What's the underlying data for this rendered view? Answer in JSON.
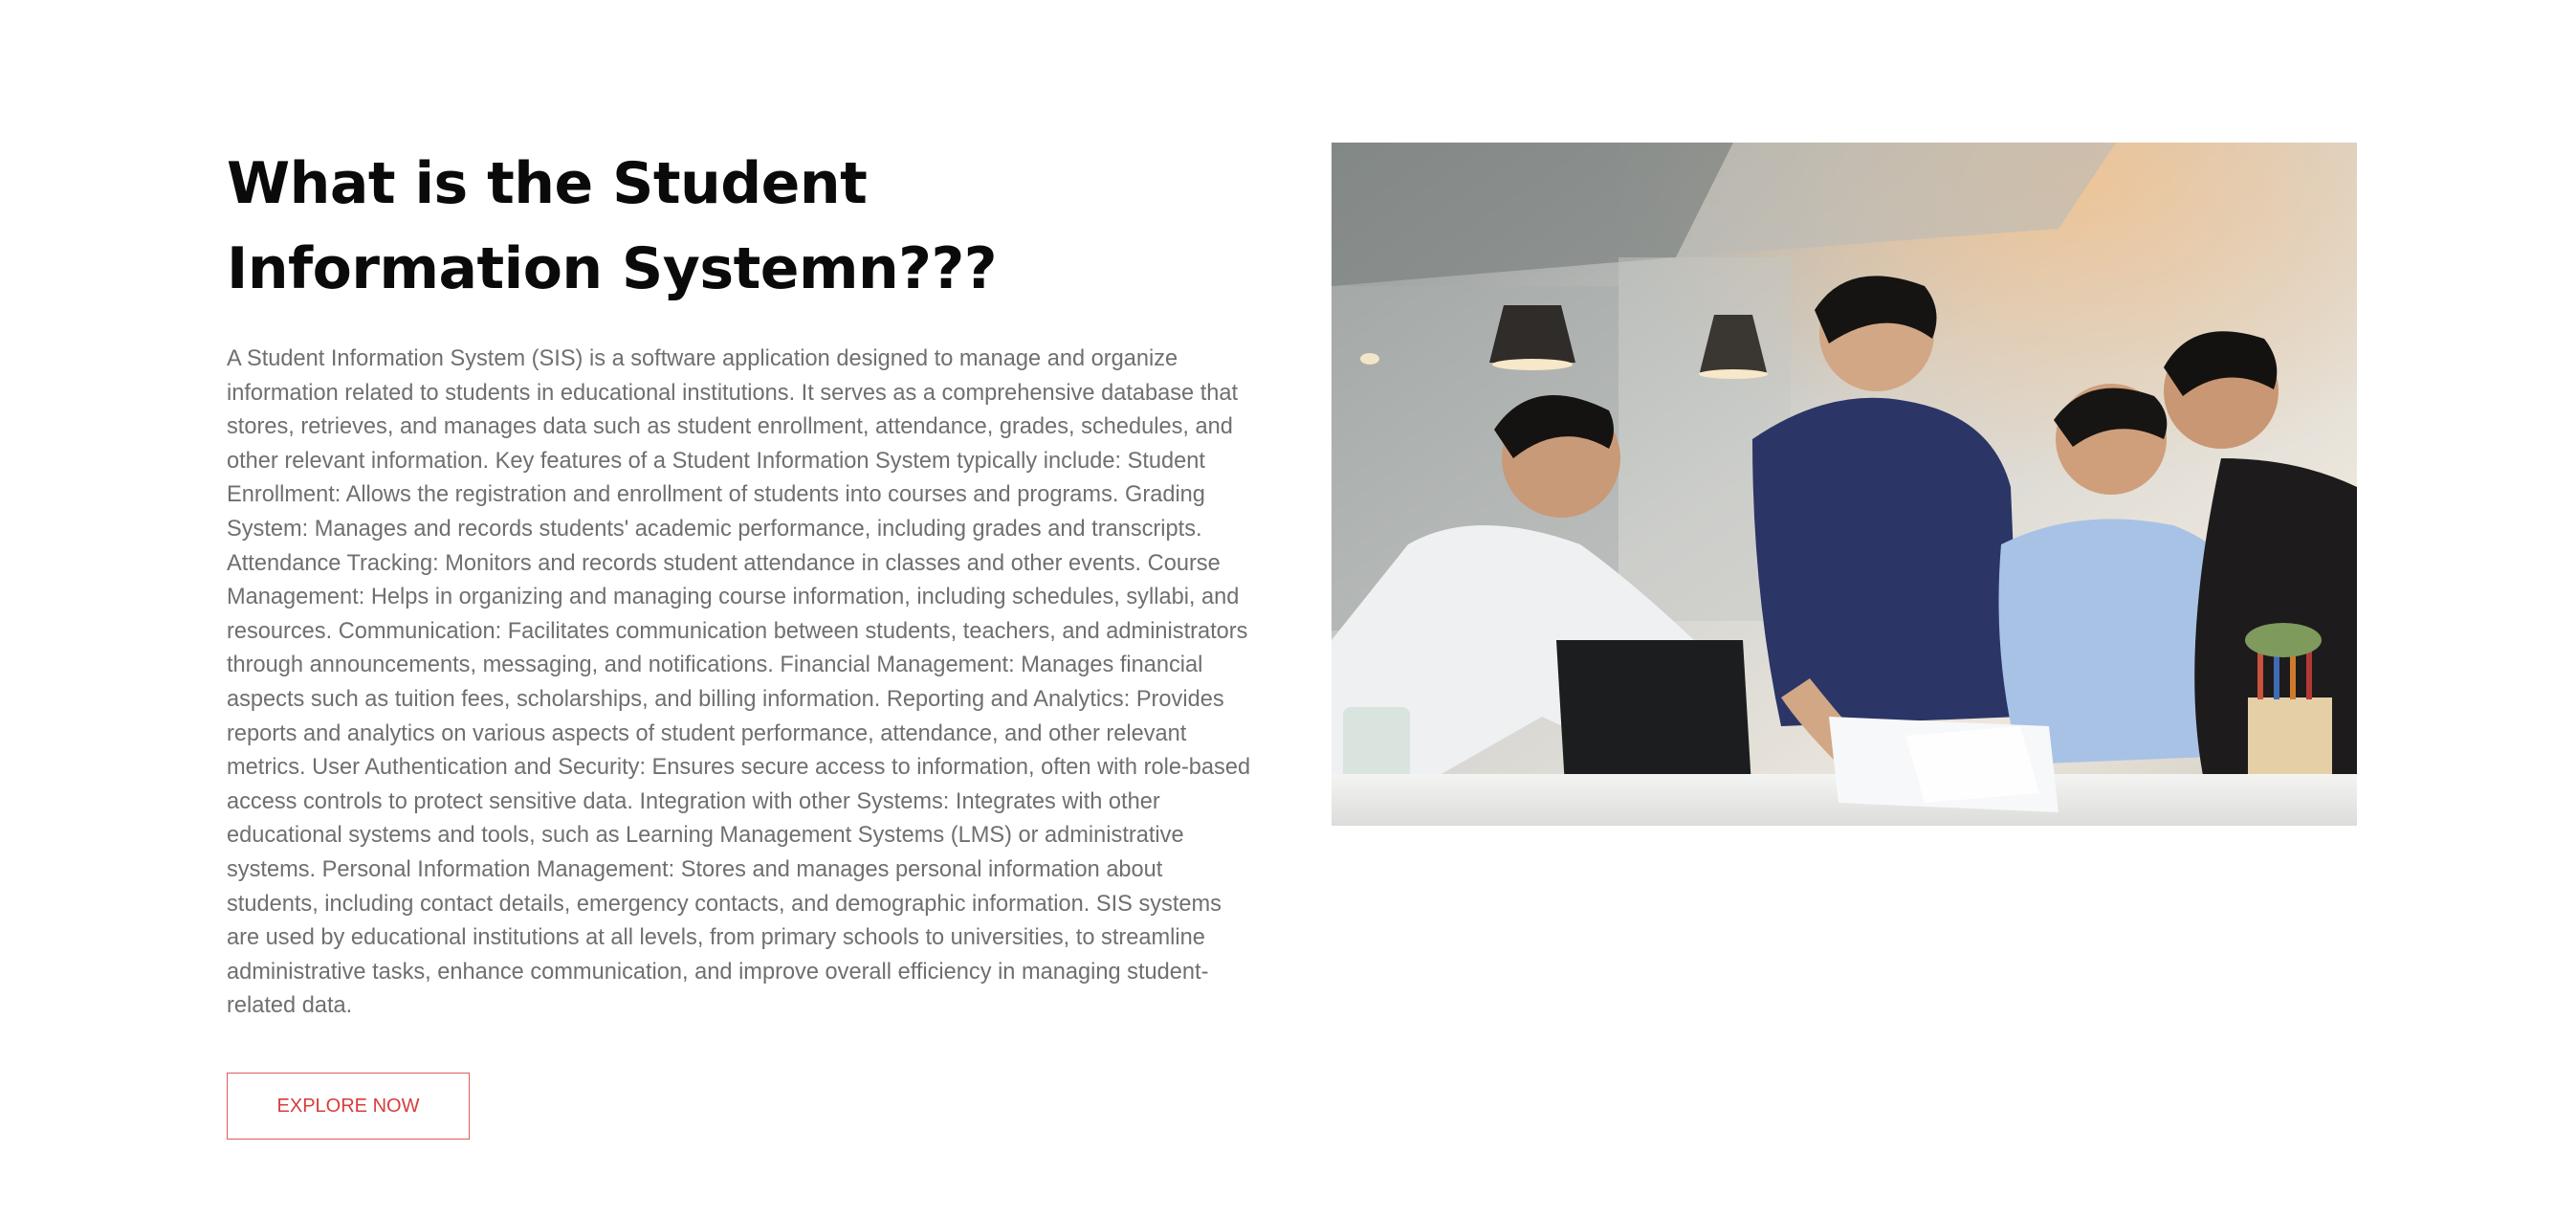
{
  "section": {
    "title": "What is the Student Information Systemn???",
    "description": "A Student Information System (SIS) is a software application designed to manage and organize information related to students in educational institutions. It serves as a comprehensive database that stores, retrieves, and manages data such as student enrollment, attendance, grades, schedules, and other relevant information. Key features of a Student Information System typically include: Student Enrollment: Allows the registration and enrollment of students into courses and programs. Grading System: Manages and records students' academic performance, including grades and transcripts. Attendance Tracking: Monitors and records student attendance in classes and other events. Course Management: Helps in organizing and managing course information, including schedules, syllabi, and resources. Communication: Facilitates communication between students, teachers, and administrators through announcements, messaging, and notifications. Financial Management: Manages financial aspects such as tuition fees, scholarships, and billing information. Reporting and Analytics: Provides reports and analytics on various aspects of student performance, attendance, and other relevant metrics. User Authentication and Security: Ensures secure access to information, often with role-based access controls to protect sensitive data. Integration with other Systems: Integrates with other educational systems and tools, such as Learning Management Systems (LMS) or administrative systems. Personal Information Management: Stores and manages personal information about students, including contact details, emergency contacts, and demographic information. SIS systems are used by educational institutions at all levels, from primary schools to universities, to streamline administrative tasks, enhance communication, and improve overall efficiency in managing student-related data.",
    "cta_label": "EXPLORE NOW"
  },
  "image": {
    "subject": "team-meeting-photo"
  },
  "colors": {
    "heading": "#0a0a0a",
    "body_text": "#6f6f6f",
    "accent": "#d83c3c",
    "background": "#ffffff"
  }
}
